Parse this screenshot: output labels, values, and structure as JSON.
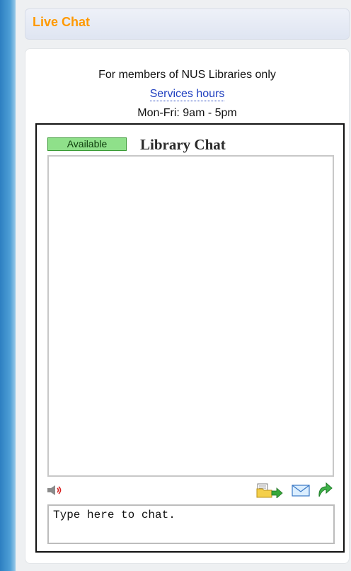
{
  "header": {
    "title": "Live Chat"
  },
  "info": {
    "members_note": "For members of NUS Libraries only",
    "hours_link": "Services hours",
    "hours_times": "Mon-Fri: 9am - 5pm"
  },
  "widget": {
    "status": "Available",
    "title": "Library Chat",
    "input_placeholder": "Type here to chat.",
    "icons": {
      "sound": "speaker-sound-icon",
      "transfer": "file-transfer-icon",
      "email": "email-icon",
      "popout": "popout-arrow-icon"
    }
  },
  "colors": {
    "header_text": "#ff9900",
    "link": "#1f3fbf",
    "available_bg": "#8fe08a"
  }
}
